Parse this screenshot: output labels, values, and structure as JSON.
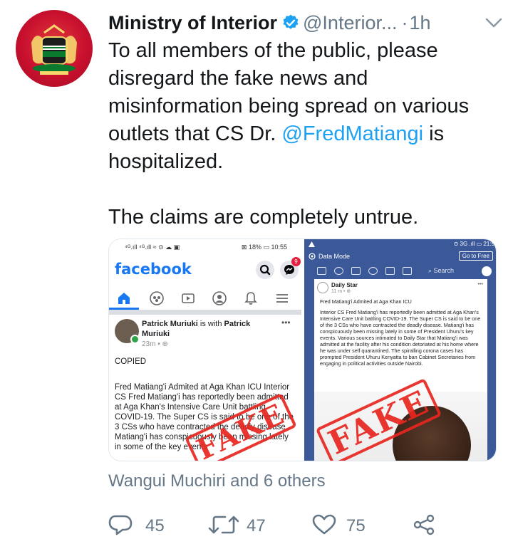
{
  "tweet": {
    "author_name": "Ministry of Interior",
    "handle": "@Interior...",
    "separator": "·",
    "time": "1h",
    "text_line_1": "To all members of the public, please disregard the fake news and misinformation being spread on various outlets that CS Dr. ",
    "mention": "@FredMatiangi",
    "text_line_1_end": " is hospitalized.",
    "text_line_2": "The claims are completely untrue.",
    "likers": "Wangui Muchiri and 6 others",
    "actions": {
      "replies": "45",
      "retweets": "47",
      "likes": "75"
    }
  },
  "media_left": {
    "status_left": "⁴ᴳ.ıll ⁴ᴳ.ıll ≈ ⊙ ☁ ▣",
    "status_right": "⊠ 18% ▭ 10:55",
    "app_name": "facebook",
    "messenger_badge": "9",
    "post_author": "Patrick Muriuki",
    "post_with": " is with ",
    "post_tagged": "Patrick Muriuki",
    "post_meta": "23m • ⊕",
    "post_more": "•••",
    "post_copied": "COPIED",
    "post_body": "Fred Matiang'i Admited at Aga Khan ICU Interior CS Fred Matiang'i has reportedly been admitted at Aga Khan's Intensive Care Unit battling COVID-19. The Super CS is said to be one of the 3 CSs who have contracted the deadly disease. Matiang'i has conspicuously been missing lately in some of the key events",
    "stamp": "FAKE"
  },
  "media_right": {
    "status_right": "⊙ 3G .ıll ▭ 21:5",
    "mode_label": "Data Mode",
    "goto_label": "Go to Free",
    "search_label": "Search",
    "page_name": "Daily Star",
    "page_time": "11 m • ⊕",
    "page_more": "•••",
    "article_title": "Fred Matiang'i Admited at Aga Khan ICU",
    "article_body": "Interior CS Fred Matiang'i has reportedly been admitted at Aga Khan's Intensive Care Unit battling COVID-19. The Super CS is said to be one of the 3 CSs who have contracted the deadly disease. Matiang'i has conspicuously been missing lately in some of President Uhuru's key events. Various sources intimated to Daily Star that Matiang'i was admitted at the facility after his condition detoriated at his home where he was under self quarantined. The spiralling corona cases has prompted President Uhuru Kenyatta to ban Cabinet Secretaries from engaging in political activities outside Nairobi.",
    "stamp": "FAKE"
  },
  "colors": {
    "accent": "#1da1f2",
    "muted": "#657786",
    "facebook_blue": "#3b5998",
    "stamp_red": "#e8261f",
    "avatar_red": "#c8102e"
  },
  "icons": [
    "verified-badge-icon",
    "caret-down-icon",
    "reply-icon",
    "retweet-icon",
    "like-icon",
    "share-icon"
  ]
}
